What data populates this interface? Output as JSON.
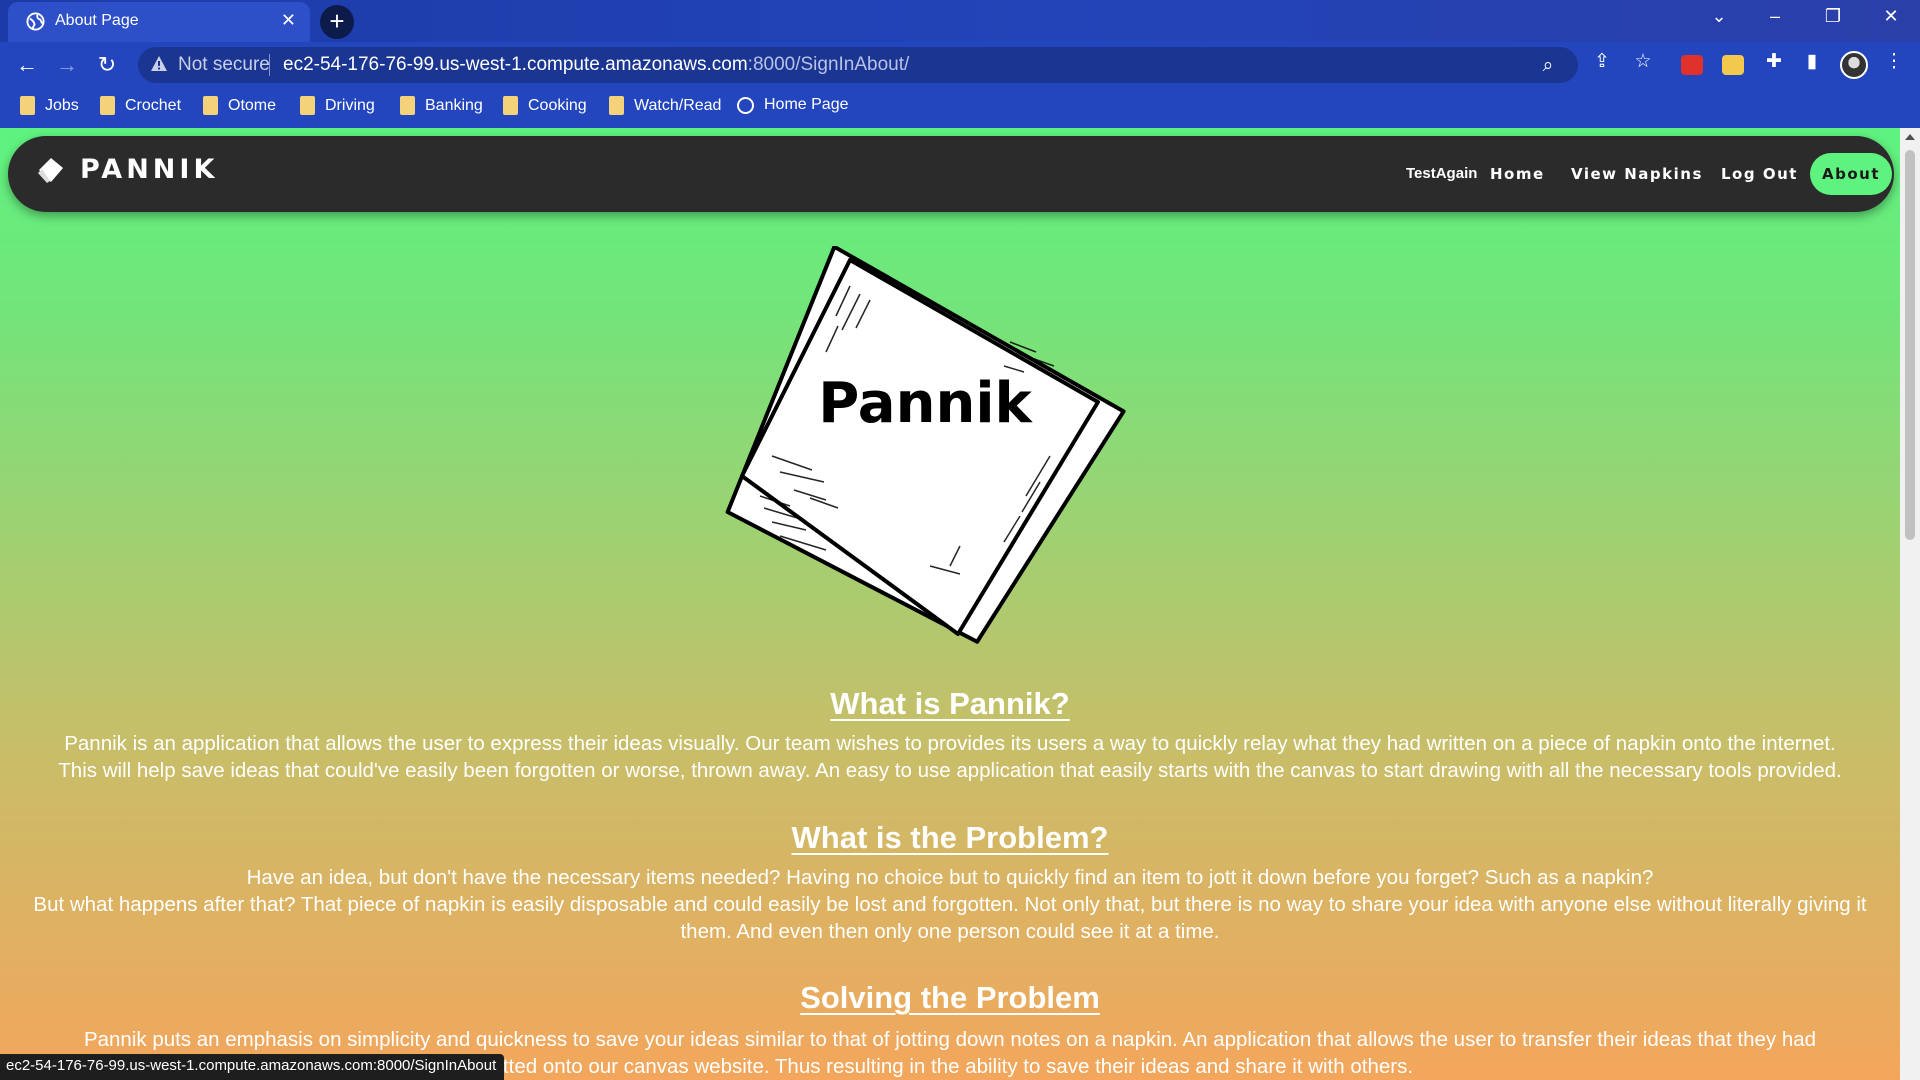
{
  "browser": {
    "tab_title": "About Page",
    "not_secure": "Not secure",
    "url_host": "ec2-54-176-76-99.us-west-1.compute.amazonaws.com",
    "url_path": ":8000/SignInAbout/",
    "bookmarks": [
      {
        "label": "Jobs",
        "icon": "folder-icon"
      },
      {
        "label": "Crochet",
        "icon": "folder-icon"
      },
      {
        "label": "Otome",
        "icon": "folder-icon"
      },
      {
        "label": "Driving",
        "icon": "folder-icon"
      },
      {
        "label": "Banking",
        "icon": "folder-icon"
      },
      {
        "label": "Cooking",
        "icon": "folder-icon"
      },
      {
        "label": "Watch/Read",
        "icon": "folder-icon"
      },
      {
        "label": "Home Page",
        "icon": "globe-icon"
      }
    ],
    "status_url": "ec2-54-176-76-99.us-west-1.compute.amazonaws.com:8000/SignInAbout"
  },
  "site": {
    "brand": "PANNIK",
    "user": "TestAgain",
    "nav": {
      "home": "Home",
      "view_napkins": "View Napkins",
      "log_out": "Log Out",
      "about": "About"
    },
    "logo_text": "Pannik",
    "accent_color": "#5ef37f"
  },
  "sections": {
    "what_heading": "What is Pannik?",
    "what_line1": "Pannik is an application that allows the user to express their ideas visually. Our team wishes to provides its users a way to quickly relay what they had written on a piece of napkin onto the internet.",
    "what_line2": "This will help save ideas that could've easily been forgotten or worse, thrown away. An easy to use application that easily starts with the canvas to start drawing with all the necessary tools provided.",
    "problem_heading": "What is the Problem?",
    "problem_line1": "Have an idea, but don't have the necessary items needed? Having no choice but to quickly find an item to jott it down before you forget? Such as a napkin?",
    "problem_line2": "But what happens after that? That piece of napkin is easily disposable and could easily be lost and forgotten. Not only that, but there is no way to share your idea with anyone else without literally giving it them. And even then only one person could see it at a time.",
    "solving_heading": "Solving the Problem",
    "solving_line1": "Pannik puts an emphasis on simplicity and quickness to save your ideas similar to that of jotting down notes on a napkin. An application that allows the user to transfer their ideas that they had",
    "solving_line2": "jotted onto our canvas website. Thus resulting in the ability to save their ideas and share it with others."
  }
}
